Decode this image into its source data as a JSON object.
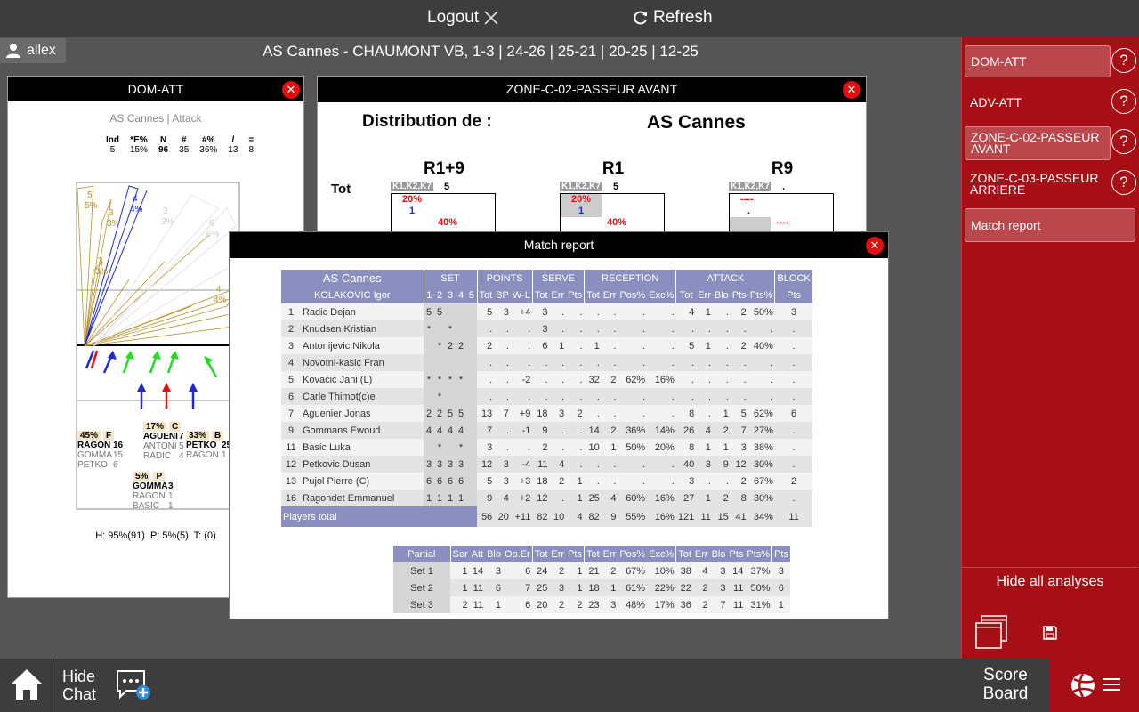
{
  "topbar": {
    "logout": "Logout",
    "refresh": "Refresh"
  },
  "user": {
    "name": "allex"
  },
  "match": {
    "title": "AS Cannes - CHAUMONT VB, 1-3 | 24-26 | 25-21 | 20-25 | 12-25"
  },
  "dom_att": {
    "title": "DOM-ATT",
    "subtitle": "AS Cannes | Attack",
    "stats_headers": [
      "Ind",
      "*E%",
      "N",
      "#",
      "#%",
      "/",
      "="
    ],
    "stats_values": [
      "5",
      "15%",
      "96",
      "35",
      "36%",
      "13",
      "8"
    ],
    "zones_top": [
      [
        "5",
        "5%"
      ],
      [
        "3",
        "3%"
      ],
      [
        "4",
        "4%"
      ],
      [
        "3",
        "3%"
      ],
      [
        "6",
        "6%"
      ],
      [
        "3",
        "3%"
      ],
      [
        "5",
        "6%"
      ],
      [
        "4",
        "4%"
      ]
    ],
    "boxes": [
      {
        "pct": "45%",
        "code": "F",
        "rows": [
          [
            "RAGON",
            "16"
          ],
          [
            "GOMMA",
            "15"
          ],
          [
            "PETKO",
            "6"
          ]
        ]
      },
      {
        "pct": "17%",
        "code": "C",
        "rows": [
          [
            "AGUENI",
            "7"
          ],
          [
            "ANTONI",
            "5"
          ],
          [
            "RADIC",
            "4"
          ]
        ]
      },
      {
        "pct": "33%",
        "code": "B",
        "rows": [
          [
            "PETKO",
            "25"
          ],
          [
            "RAGON",
            "1"
          ]
        ]
      },
      {
        "pct": "5%",
        "code": "P",
        "rows": [
          [
            "GOMMA",
            "3"
          ],
          [
            "RAGON",
            "1"
          ],
          [
            "BASIC",
            "1"
          ]
        ]
      }
    ],
    "footer": "H: 95%(91)  P: 5%(5)  T: (0)"
  },
  "zone_win": {
    "title": "ZONE-C-02-PASSEUR AVANT",
    "dist_label": "Distribution de :",
    "team": "AS Cannes",
    "tot": "Tot",
    "groups": [
      {
        "label": "R1+9",
        "tag": "K1,K2,K7",
        "n": "5",
        "v1": "20%",
        "v2": "1",
        "v3": "40%"
      },
      {
        "label": "R1",
        "tag": "K1,K2,K7",
        "n": "5",
        "v1": "20%",
        "v2": "1",
        "v3": "40%"
      },
      {
        "label": "R9",
        "tag": "K1,K2,K7",
        "n": ".",
        "v1": "----",
        "v2": ".",
        "v3": "----"
      }
    ]
  },
  "match_report": {
    "title": "Match report",
    "team": "AS Cannes",
    "coach": "KOLAKOVIC Igor",
    "groups": [
      "SET",
      "POINTS",
      "SERVE",
      "RECEPTION",
      "ATTACK",
      "BLOCK"
    ],
    "subheaders": [
      "1",
      "2",
      "3",
      "4",
      "5",
      "Tot",
      "BP",
      "W-L",
      "Tot",
      "Err",
      "Pts",
      "Tot",
      "Err",
      "Pos%",
      "Exc%",
      "Tot",
      "Err",
      "Blo",
      "Pts",
      "Pts%",
      "Pts"
    ],
    "players": [
      {
        "num": "1",
        "name": "Radic Dejan",
        "sets": [
          "5",
          "5",
          "",
          "",
          ""
        ],
        "vals": [
          "5",
          "3",
          "+4",
          "3",
          ".",
          ".",
          ".",
          ".",
          ".",
          ".",
          "4",
          "1",
          ".",
          "2",
          "50%",
          "3"
        ]
      },
      {
        "num": "2",
        "name": "Knudsen Kristian",
        "sets": [
          "*",
          "",
          "*",
          "",
          ""
        ],
        "vals": [
          ".",
          ".",
          ".",
          "3",
          ".",
          ".",
          ".",
          ".",
          ".",
          ".",
          ".",
          ".",
          ".",
          ".",
          ".",
          "."
        ]
      },
      {
        "num": "3",
        "name": "Antonijevic Nikola",
        "sets": [
          "",
          "*",
          "2",
          "2",
          ""
        ],
        "vals": [
          "2",
          ".",
          ".",
          "6",
          "1",
          ".",
          "1",
          ".",
          ".",
          ".",
          "5",
          "1",
          ".",
          "2",
          "40%",
          "."
        ]
      },
      {
        "num": "4",
        "name": "Novotni-kasic Fran",
        "sets": [
          "",
          "",
          "",
          "",
          ""
        ],
        "vals": [
          ".",
          ".",
          ".",
          ".",
          ".",
          ".",
          ".",
          ".",
          ".",
          ".",
          ".",
          ".",
          ".",
          ".",
          ".",
          "."
        ]
      },
      {
        "num": "5",
        "name": "Kovacic Jani (L)",
        "sets": [
          "*",
          "*",
          "*",
          "*",
          ""
        ],
        "vals": [
          ".",
          ".",
          "-2",
          ".",
          ".",
          ".",
          "32",
          "2",
          "62%",
          "16%",
          ".",
          ".",
          ".",
          ".",
          ".",
          "."
        ]
      },
      {
        "num": "6",
        "name": "Carle Thimot(c)e",
        "sets": [
          "",
          "*",
          "",
          "",
          ""
        ],
        "vals": [
          ".",
          ".",
          ".",
          ".",
          ".",
          ".",
          ".",
          ".",
          ".",
          ".",
          ".",
          ".",
          ".",
          ".",
          ".",
          "."
        ]
      },
      {
        "num": "7",
        "name": "Aguenier Jonas",
        "sets": [
          "2",
          "2",
          "5",
          "5",
          ""
        ],
        "vals": [
          "13",
          "7",
          "+9",
          "18",
          "3",
          "2",
          ".",
          ".",
          ".",
          ".",
          "8",
          ".",
          "1",
          "5",
          "62%",
          "6"
        ]
      },
      {
        "num": "9",
        "name": "Gommans Ewoud",
        "sets": [
          "4",
          "4",
          "4",
          "4",
          ""
        ],
        "vals": [
          "7",
          ".",
          "-1",
          "9",
          ".",
          ".",
          "14",
          "2",
          "36%",
          "14%",
          "26",
          "4",
          "2",
          "7",
          "27%",
          "."
        ]
      },
      {
        "num": "11",
        "name": "Basic Luka",
        "sets": [
          "",
          "*",
          "",
          "*",
          ""
        ],
        "vals": [
          "3",
          ".",
          ".",
          "2",
          ".",
          ".",
          "10",
          "1",
          "50%",
          "20%",
          "8",
          "1",
          "1",
          "3",
          "38%",
          "."
        ]
      },
      {
        "num": "12",
        "name": "Petkovic Dusan",
        "sets": [
          "3",
          "3",
          "3",
          "3",
          ""
        ],
        "vals": [
          "12",
          "3",
          "-4",
          "11",
          "4",
          ".",
          ".",
          ".",
          ".",
          ".",
          "40",
          "3",
          "9",
          "12",
          "30%",
          "."
        ]
      },
      {
        "num": "13",
        "name": "Pujol Pierre (C)",
        "sets": [
          "6",
          "6",
          "6",
          "6",
          ""
        ],
        "vals": [
          "5",
          "3",
          "+3",
          "18",
          "2",
          "1",
          ".",
          ".",
          ".",
          ".",
          "3",
          ".",
          ".",
          "2",
          "67%",
          "2"
        ]
      },
      {
        "num": "16",
        "name": "Ragondet Emmanuel",
        "sets": [
          "1",
          "1",
          "1",
          "1",
          ""
        ],
        "vals": [
          "9",
          "4",
          "+2",
          "12",
          ".",
          "1",
          "25",
          "4",
          "60%",
          "16%",
          "27",
          "1",
          "2",
          "8",
          "30%",
          "."
        ]
      }
    ],
    "total_label": "Players total",
    "totals": [
      "56",
      "20",
      "+11",
      "82",
      "10",
      "4",
      "82",
      "9",
      "55%",
      "16%",
      "121",
      "11",
      "15",
      "41",
      "34%",
      "11"
    ],
    "partial_headers": [
      "Partial",
      "Ser",
      "Att",
      "Blo",
      "Op.Er",
      "Tot",
      "Err",
      "Pts",
      "Tot",
      "Err",
      "Pos%",
      "Exc%",
      "Tot",
      "Err",
      "Blo",
      "Pts",
      "Pts%",
      "Pts"
    ],
    "partials": [
      {
        "label": "Set 1",
        "vals": [
          "1",
          "14",
          "3",
          "6",
          "24",
          "2",
          "1",
          "21",
          "2",
          "67%",
          "10%",
          "38",
          "4",
          "3",
          "14",
          "37%",
          "3"
        ]
      },
      {
        "label": "Set 2",
        "vals": [
          "1",
          "11",
          "6",
          "7",
          "25",
          "3",
          "1",
          "18",
          "1",
          "61%",
          "22%",
          "22",
          "2",
          "3",
          "11",
          "50%",
          "6"
        ]
      },
      {
        "label": "Set 3",
        "vals": [
          "2",
          "11",
          "1",
          "6",
          "20",
          "2",
          "2",
          "23",
          "3",
          "48%",
          "17%",
          "36",
          "2",
          "7",
          "11",
          "31%",
          "1"
        ]
      }
    ]
  },
  "right_panel": {
    "items": [
      {
        "label": "DOM-ATT",
        "active": true
      },
      {
        "label": "ADV-ATT",
        "active": false
      },
      {
        "label": "ZONE-C-02-PASSEUR AVANT",
        "active": true
      },
      {
        "label": "ZONE-C-03-PASSEUR ARRIERE",
        "active": false
      },
      {
        "label": "Match report",
        "active": true
      }
    ],
    "hide_all": "Hide all analyses"
  },
  "bottom": {
    "hide_chat": "Hide Chat",
    "score_board": "Score Board"
  },
  "colors": {
    "accent_red": "#a50f15",
    "header_purple": "#8b8fbf",
    "bar_dark": "#3d3d3d"
  }
}
